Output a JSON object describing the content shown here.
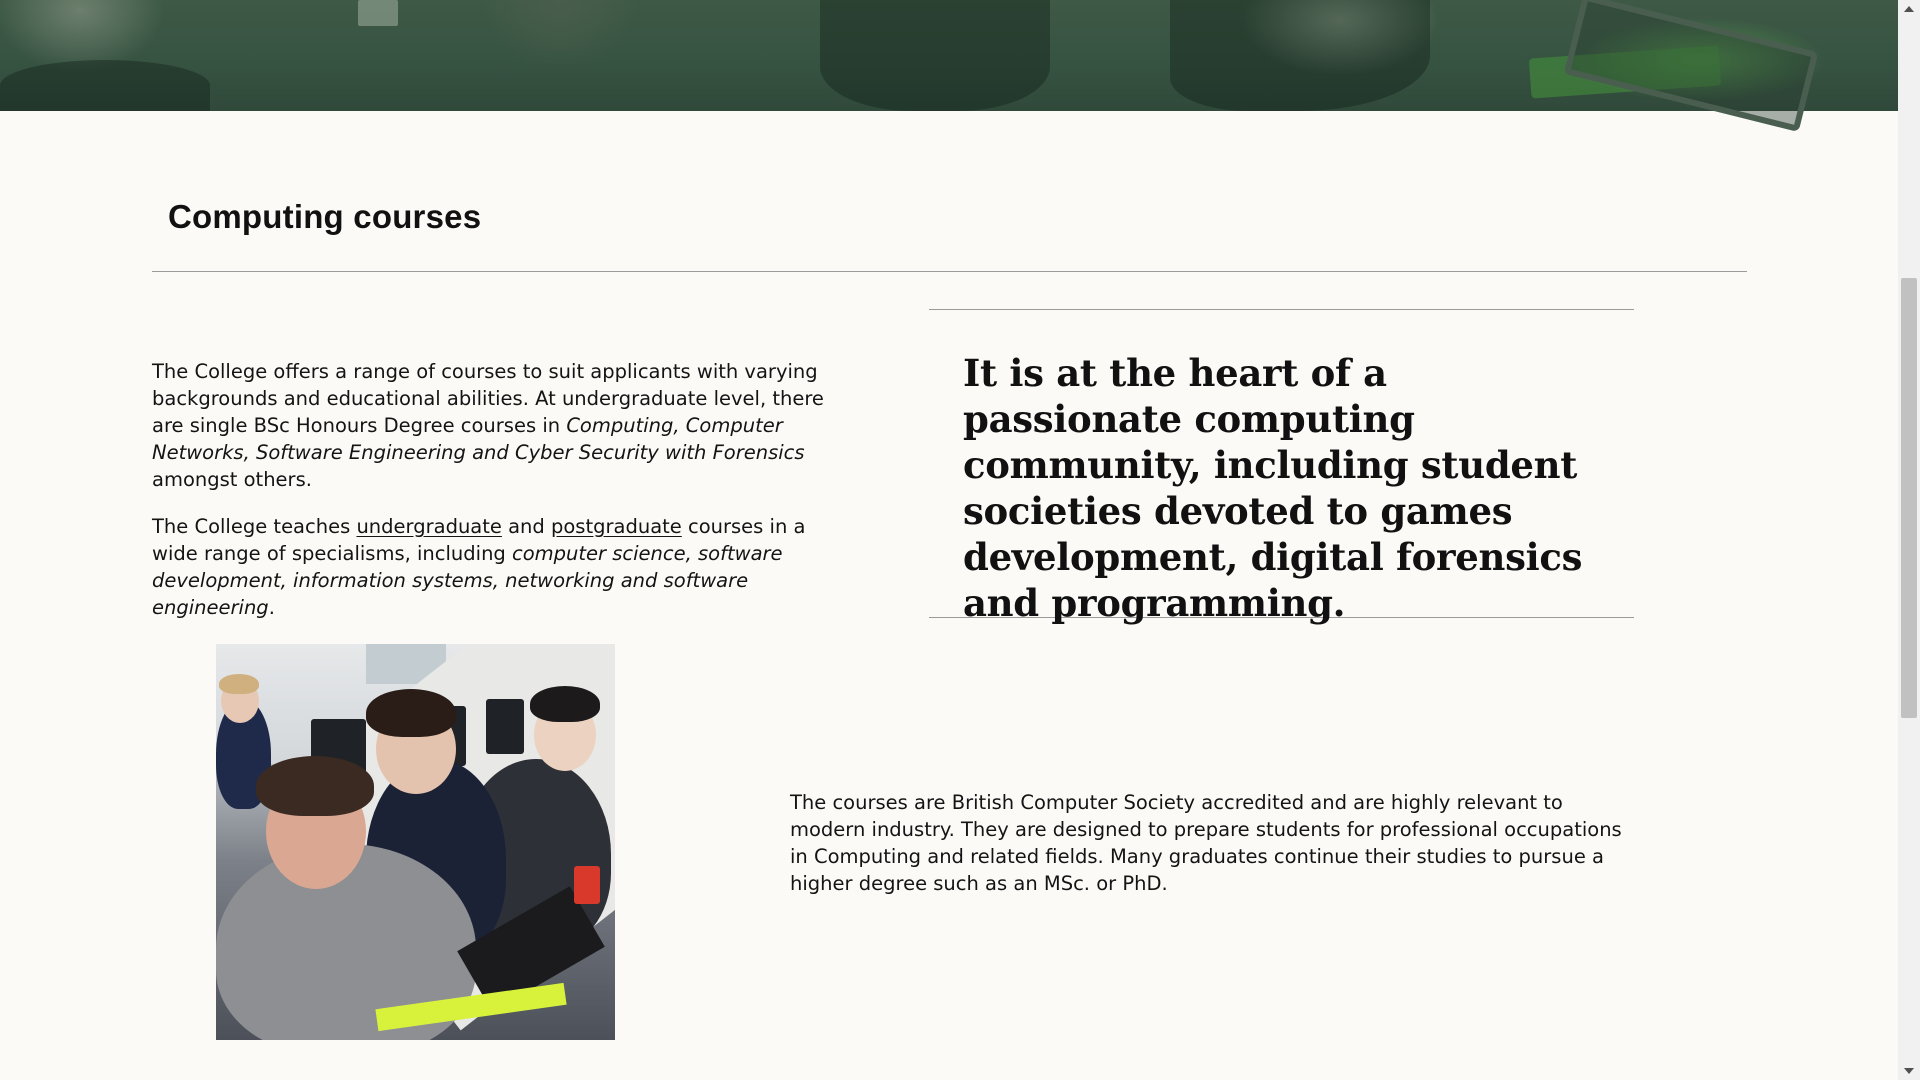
{
  "hero": {
    "image_desc_icon": "hero-banner-image"
  },
  "section": {
    "title": "Computing courses"
  },
  "intro": {
    "p1_a": "The College offers a range of courses to suit applicants with varying backgrounds and educational abilities. At undergraduate level, there are single BSc Honours Degree courses in ",
    "p1_em": "Computing, Computer Networks, Software Engineering and Cyber Security with Forensics",
    "p1_b": " amongst others.",
    "p2_a": "The College teaches ",
    "p2_link1": "undergraduate",
    "p2_and": " and ",
    "p2_link2": "postgraduate",
    "p2_b": " courses in a wide range of specialisms, including ",
    "p2_em": "computer science, software development, information systems, networking and software engineering",
    "p2_c": "."
  },
  "quote": {
    "text": "It is at the heart of a passionate computing community, including student societies devoted to games development, digital forensics and programming."
  },
  "photo": {
    "icon": "students-at-laptop-photo"
  },
  "accreditation": {
    "text": "The courses are British Computer Society accredited and are highly relevant to modern industry. They are designed to prepare students for professional occupations in Computing and related fields. Many graduates continue their studies to pursue a higher degree such as an MSc. or PhD."
  },
  "colors": {
    "page_background": "#fbfaf7",
    "hero_green": "#365241",
    "text": "#111111",
    "rule": "#9a9a9a"
  }
}
